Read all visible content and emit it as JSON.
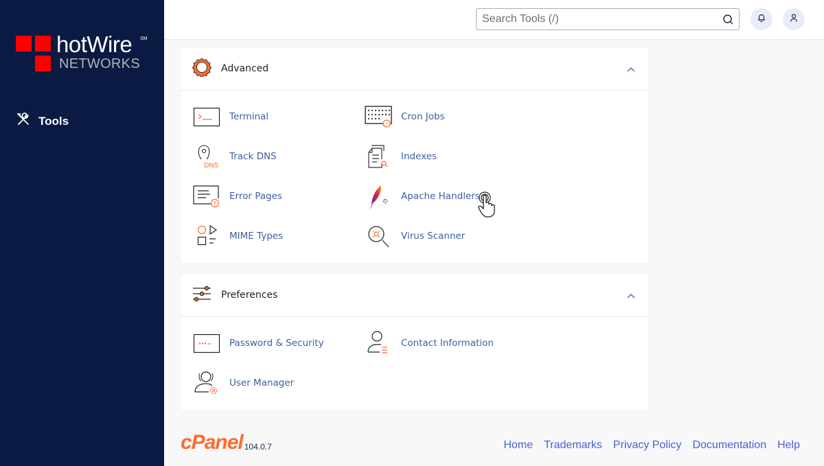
{
  "sidebar": {
    "logo": {
      "brand": "hotWire",
      "mark": "SM",
      "sub": "NETWORKS"
    },
    "nav": [
      {
        "label": "Tools",
        "icon": "tools-icon"
      }
    ]
  },
  "header": {
    "search": {
      "placeholder": "Search Tools (/)",
      "value": ""
    },
    "notifications_icon": "bell-icon",
    "user_icon": "user-icon"
  },
  "sections": [
    {
      "title": "Advanced",
      "icon": "gear-icon",
      "expanded": true,
      "items": [
        {
          "label": "Terminal",
          "icon": "terminal-icon"
        },
        {
          "label": "Cron Jobs",
          "icon": "cron-jobs-icon"
        },
        {
          "label": "Track DNS",
          "icon": "track-dns-icon",
          "icon_text": "DNS"
        },
        {
          "label": "Indexes",
          "icon": "indexes-icon"
        },
        {
          "label": "Error Pages",
          "icon": "error-pages-icon"
        },
        {
          "label": "Apache Handlers",
          "icon": "apache-feather-icon"
        },
        {
          "label": "MIME Types",
          "icon": "mime-types-icon"
        },
        {
          "label": "Virus Scanner",
          "icon": "virus-scanner-icon"
        }
      ]
    },
    {
      "title": "Preferences",
      "icon": "sliders-icon",
      "expanded": true,
      "items": [
        {
          "label": "Password & Security",
          "icon": "password-icon",
          "icon_text": "***-"
        },
        {
          "label": "Contact Information",
          "icon": "contact-icon"
        },
        {
          "label": "User Manager",
          "icon": "user-manager-icon"
        }
      ]
    }
  ],
  "footer": {
    "brand": "cPanel",
    "version": "104.0.7",
    "links": [
      "Home",
      "Trademarks",
      "Privacy Policy",
      "Documentation",
      "Help"
    ]
  },
  "colors": {
    "sidebar_bg": "#0b1a42",
    "accent_orange": "#ff6c2c",
    "link_blue": "#3d5f9e",
    "footer_link": "#4a5fd3",
    "logo_red": "#ff0000"
  }
}
